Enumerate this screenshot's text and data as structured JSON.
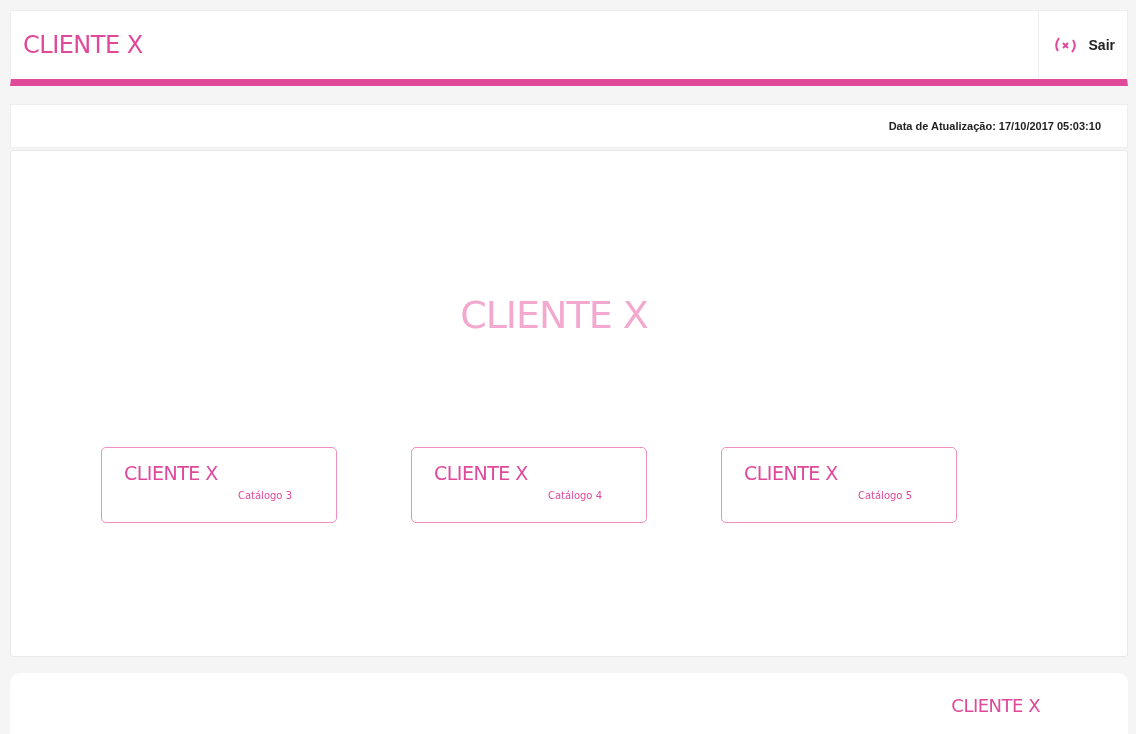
{
  "header": {
    "title": "CLIENTE X",
    "logout": "Sair"
  },
  "update": {
    "text": "Data de Atualização: 17/10/2017 05:03:10"
  },
  "watermark": "CLIENTE X",
  "cards": [
    {
      "title": "CLIENTE X",
      "subtitle": "Catálogo 3"
    },
    {
      "title": "CLIENTE X",
      "subtitle": "Catálogo 4"
    },
    {
      "title": "CLIENTE X",
      "subtitle": "Catálogo 5"
    }
  ],
  "footer": {
    "brand": "CLIENTE X"
  }
}
